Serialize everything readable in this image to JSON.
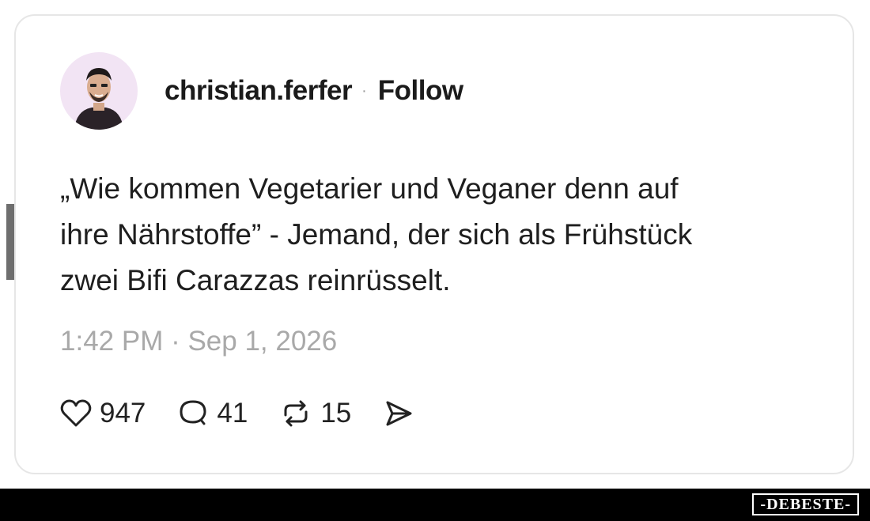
{
  "post": {
    "username": "christian.ferfer",
    "separator": "·",
    "follow_label": "Follow",
    "text_lines": [
      "„Wie kommen Vegetarier und Veganer denn auf",
      "ihre Nährstoffe” - Jemand, der sich als Frühstück",
      "zwei Bifi Carazzas reinrüsselt."
    ],
    "timestamp": "1:42 PM · Sep 1, 2026",
    "actions": {
      "likes": "947",
      "replies": "41",
      "reposts": "15",
      "icons": [
        "heart-icon",
        "comment-icon",
        "repost-icon",
        "share-icon"
      ]
    }
  },
  "watermark": {
    "side_text": "DEBESTE",
    "footer_text": "-DEBESTE-"
  },
  "colors": {
    "text": "#1e1e1e",
    "muted": "#a9a9a9",
    "card_border": "#e6e6e6",
    "avatar_bg": "#f2e4f4",
    "footer_bg": "#000000"
  }
}
